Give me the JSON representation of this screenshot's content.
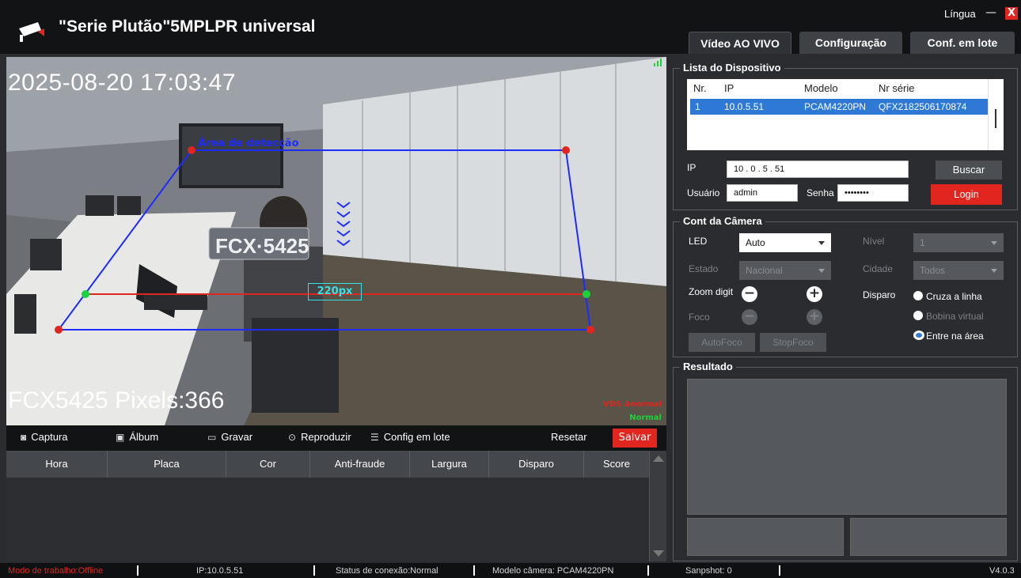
{
  "app": {
    "title": "\"Serie Plutão\"5MPLPR universal",
    "language_label": "Língua",
    "minimize": "—",
    "close": "X"
  },
  "tabs": [
    {
      "label": "Vídeo AO VIVO",
      "active": true
    },
    {
      "label": "Configuração",
      "active": false
    },
    {
      "label": "Conf. em lote",
      "active": false
    }
  ],
  "video": {
    "timestamp": "2025-08-20 17:03:47",
    "detection_area_label": "Área de detecção",
    "pixel_measure": "220px",
    "plate_overlay": "FCX5425 Pixels:366",
    "plate_on_frame": "FCX·5425",
    "vds_abnormal": "VDS Anormal",
    "vds_normal": "Normal"
  },
  "toolbar": {
    "capture": "Captura",
    "album": "Álbum",
    "record": "Gravar",
    "play": "Reproduzir",
    "batch": "Config em lote",
    "reset": "Resetar",
    "save": "Salvar"
  },
  "results_table": {
    "columns": [
      "Hora",
      "Placa",
      "Cor",
      "Anti-fraude",
      "Largura",
      "Disparo",
      "Score"
    ],
    "rows": []
  },
  "device_list": {
    "legend": "Lista do Dispositivo",
    "columns": [
      "Nr.",
      "IP",
      "Modelo",
      "Nr série"
    ],
    "rows": [
      {
        "nr": "1",
        "ip": "10.0.5.51",
        "model": "PCAM4220PN",
        "serial": "QFX2182506170874"
      }
    ],
    "ip_label": "IP",
    "ip_value": "10  .  0   .  5   .  51",
    "user_label": "Usuário",
    "user_value": "admin",
    "password_label": "Senha",
    "password_value": "••••••••",
    "search_button": "Buscar",
    "login_button": "Login"
  },
  "camera": {
    "legend": "Cont da Câmera",
    "led_label": "LED",
    "led_value": "Auto",
    "level_label": "Nível",
    "level_value": "1",
    "state_label": "Estado",
    "state_value": "Nacional",
    "city_label": "Cidade",
    "city_value": "Todos",
    "zoom_label": "Zoom digit",
    "focus_label": "Foco",
    "trigger_label": "Disparo",
    "trigger_options": [
      "Cruza a linha",
      "Bobina virtual",
      "Entre na área"
    ],
    "trigger_selected": "Entre na área",
    "autofocus_button": "AutoFoco",
    "stopfocus_button": "StopFoco"
  },
  "result": {
    "legend": "Resultado"
  },
  "status": {
    "mode": "Modo de trabalho:Offline",
    "ip": "IP:10.0.5.51",
    "connection": "Status de conexão:Normal",
    "model": "Modelo câmera: PCAM4220PN",
    "snapshot": "Sanpshot: 0",
    "version": "V4.0.3"
  },
  "colors": {
    "accent_red": "#e0261f",
    "selection_blue": "#2f79d6",
    "detection_blue": "#1d2bff",
    "trigger_line_red": "#e0261f",
    "measure_cyan": "#39e0e6"
  }
}
